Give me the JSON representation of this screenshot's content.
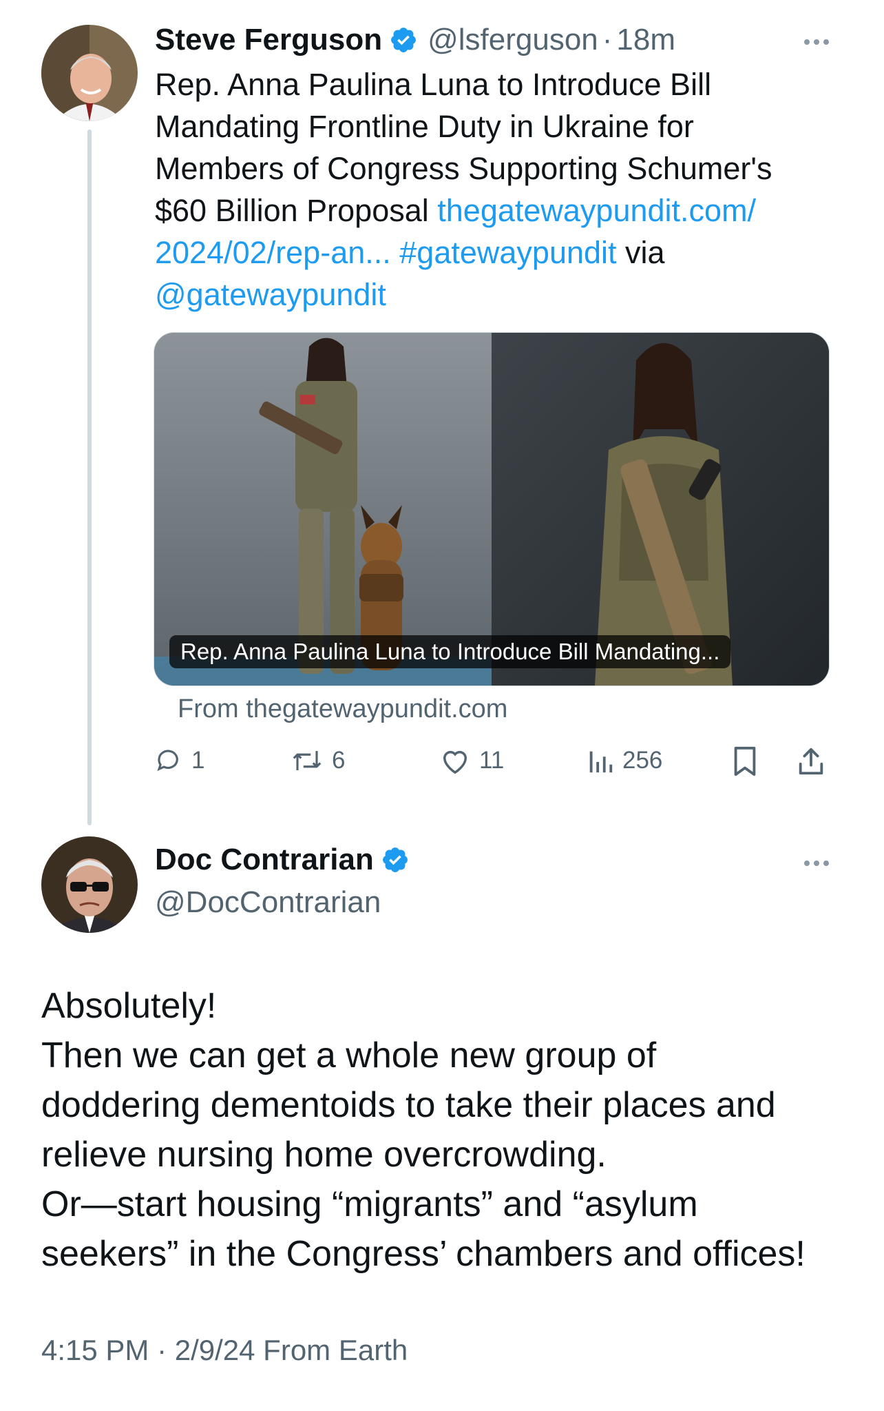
{
  "tweet1": {
    "author_name": "Steve Ferguson",
    "handle": "@lsferguson",
    "separator": "·",
    "time": "18m",
    "text_line1": "Rep. Anna Paulina Luna to Introduce Bill",
    "text_line2": "Mandating Frontline Duty in Ukraine for",
    "text_line3": "Members of Congress Supporting Schumer's",
    "text_line4_plain": "$60 Billion Proposal ",
    "link_part1": "thegatewaypundit.com/",
    "link_part2": "2024/02/rep-an...",
    "hashtag": "#gatewaypundit",
    "via": " via",
    "mention": "@gatewaypundit",
    "card_caption": "Rep. Anna Paulina Luna to Introduce Bill Mandating...",
    "card_source": "From thegatewaypundit.com",
    "replies": "1",
    "reposts": "6",
    "likes": "11",
    "views": "256"
  },
  "tweet2": {
    "author_name": "Doc Contrarian",
    "handle": "@DocContrarian",
    "body_line1": "Absolutely!",
    "body_line2": "Then we can get a whole new group of",
    "body_line3": "doddering dementoids to take their places and",
    "body_line4": "relieve nursing home overcrowding.",
    "body_line5": "Or—start housing “migrants” and “asylum",
    "body_line6": "seekers” in the Congress’ chambers and offices!",
    "timestamp": "4:15 PM · 2/9/24 From Earth"
  },
  "icons": {
    "verified": "verified-badge-icon",
    "more": "more-icon",
    "reply": "reply-icon",
    "repost": "repost-icon",
    "like": "like-icon",
    "views": "views-icon",
    "bookmark": "bookmark-icon",
    "share": "share-icon"
  },
  "colors": {
    "link": "#1d9bf0",
    "secondary_text": "#536471",
    "verified": "#1d9bf0"
  }
}
